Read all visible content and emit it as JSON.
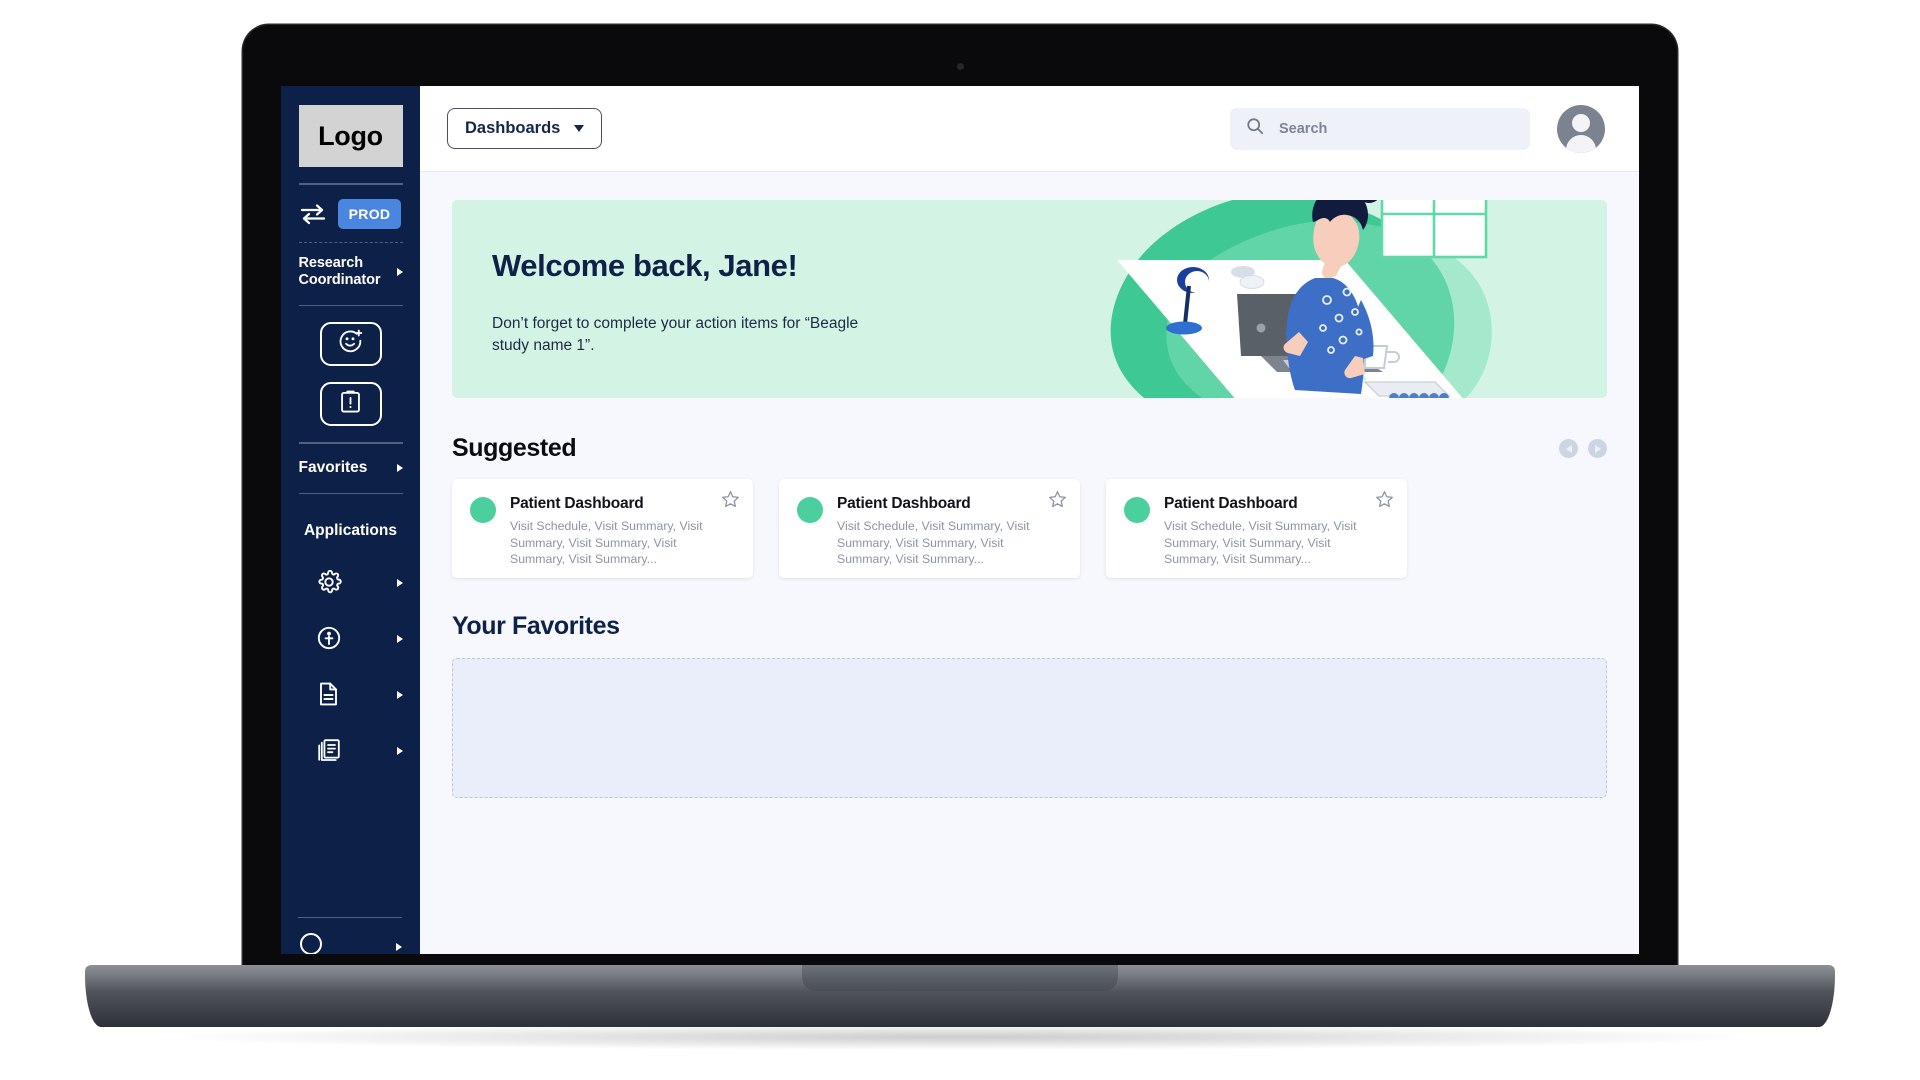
{
  "device": {
    "model_label": "MacBook Air"
  },
  "sidebar": {
    "logo_text": "Logo",
    "environment": {
      "icon": "swap-arrows-icon",
      "badge": "PROD"
    },
    "role": {
      "label": "Research Coordinator",
      "chevron": "chevron-right-icon"
    },
    "quick_actions": [
      {
        "name": "add-person-icon",
        "label": ""
      },
      {
        "name": "clipboard-alert-icon",
        "label": ""
      }
    ],
    "favorites": {
      "label": "Favorites",
      "chevron": "chevron-right-icon"
    },
    "applications_heading": "Applications",
    "applications": [
      {
        "icon": "gear-icon",
        "chevron": "chevron-right-icon"
      },
      {
        "icon": "person-circle-icon",
        "chevron": "chevron-right-icon"
      },
      {
        "icon": "document-icon",
        "chevron": "chevron-right-icon"
      },
      {
        "icon": "stacked-documents-icon",
        "chevron": "chevron-right-icon"
      }
    ],
    "bottom_item": {
      "icon": "help-icon",
      "chevron": "chevron-right-icon"
    }
  },
  "topbar": {
    "dashboards_label": "Dashboards",
    "dashboards_caret": "chevron-down-icon",
    "search": {
      "placeholder": "Search",
      "value": "",
      "icon": "search-icon"
    },
    "avatar": "user-avatar"
  },
  "banner": {
    "heading": "Welcome back, Jane!",
    "subtext": "Don’t forget to complete your action items for “Beagle study name 1”.",
    "illustration": "woman-at-desk-illustration"
  },
  "suggested": {
    "title": "Suggested",
    "prev_label": "previous",
    "next_label": "next",
    "cards": [
      {
        "title": "Patient Dashboard",
        "description": "Visit Schedule, Visit Summary, Visit Summary, Visit Summary, Visit Summary, Visit Summary...",
        "star": "star-outline-icon",
        "dot_color": "#4ccf9e"
      },
      {
        "title": "Patient Dashboard",
        "description": "Visit Schedule, Visit Summary, Visit Summary, Visit Summary, Visit Summary, Visit Summary...",
        "star": "star-outline-icon",
        "dot_color": "#4ccf9e"
      },
      {
        "title": "Patient Dashboard",
        "description": "Visit Schedule, Visit Summary, Visit Summary, Visit Summary, Visit Summary, Visit Summary...",
        "star": "star-outline-icon",
        "dot_color": "#4ccf9e"
      }
    ]
  },
  "favorites_section": {
    "title": "Your Favorites",
    "empty_area": ""
  },
  "colors": {
    "sidebar_bg": "#0d2048",
    "prod_badge": "#4a86df",
    "banner_bg": "#d3f4e4",
    "accent_green": "#4ccf9e",
    "page_bg": "#f6f8fd",
    "navy_text": "#0e2148"
  }
}
